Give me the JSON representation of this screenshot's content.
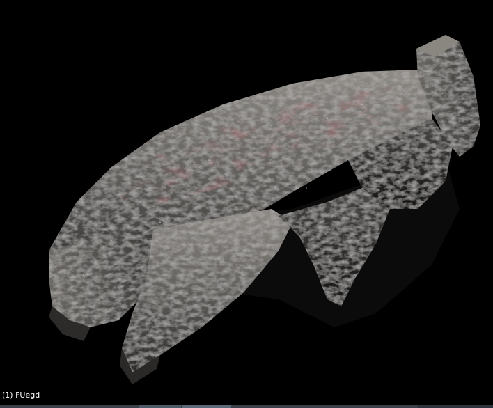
{
  "viewport": {
    "object_label": "(1) FUegd",
    "background_color": "#000000",
    "label_color": "#ffffff"
  },
  "scene": {
    "object": "rock-sculpt-mesh",
    "rock_base_color": "#5f5d5a",
    "rock_highlight_color": "#9a9690",
    "rock_shadow_color": "#1e1d1c",
    "rock_stain_color": "#6a2a2e"
  }
}
